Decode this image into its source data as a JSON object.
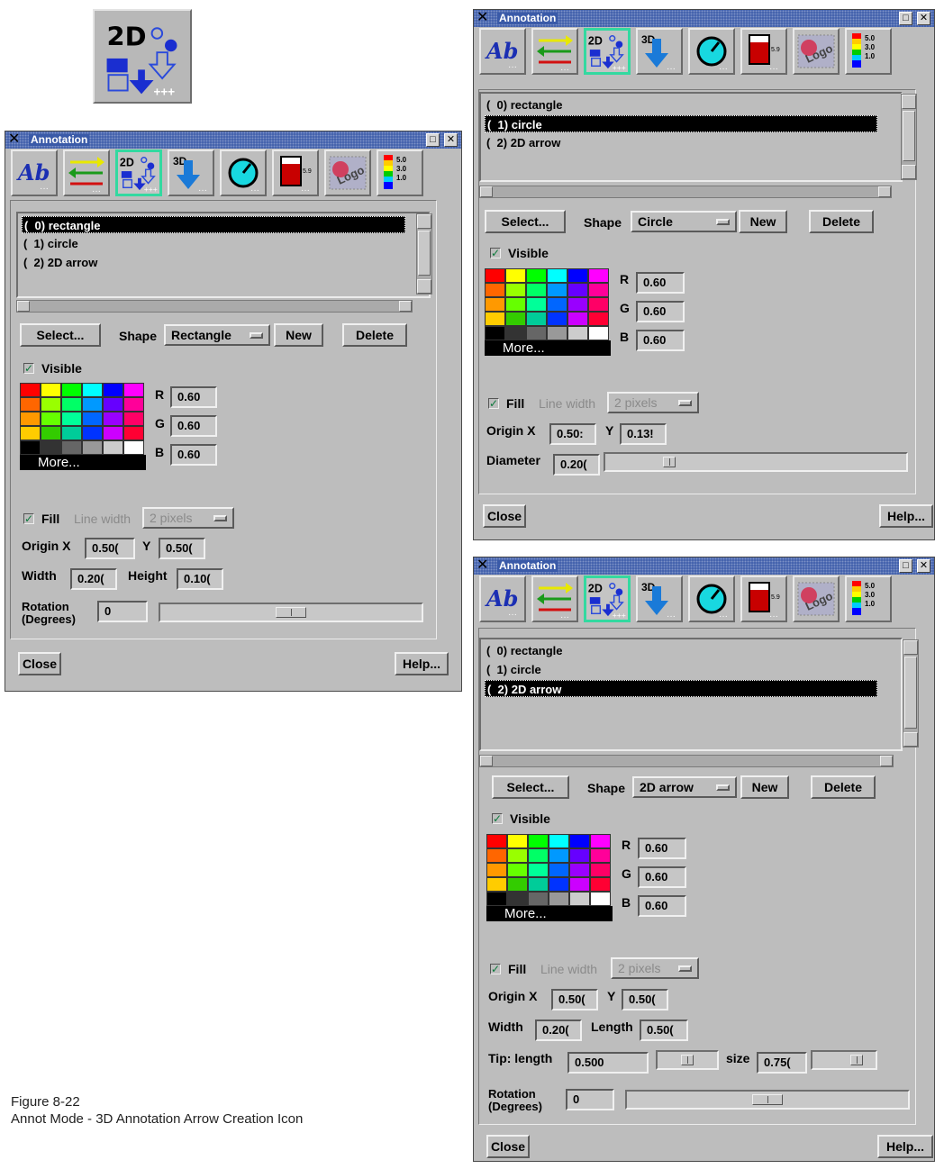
{
  "caption": {
    "line1": "Figure 8-22",
    "line2": "Annot Mode - 3D Annotation Arrow Creation Icon"
  },
  "big_icon": {
    "label": "2D"
  },
  "window_common": {
    "title": "Annotation",
    "tools": [
      "text-tool-icon",
      "line-tool-icon",
      "2d-shape-tool-icon",
      "3d-arrow-tool-icon",
      "dial-tool-icon",
      "color-bar-tool-icon",
      "logo-tool-icon",
      "legend-tool-icon"
    ],
    "tool_glyphs": {
      "text": "Ab",
      "shape2d": "2D",
      "arrow3d": "3D",
      "colorbar": "5.9",
      "logo": "Logo",
      "legend_values": [
        "5.0",
        "3.0",
        "1.0"
      ]
    },
    "list_items": [
      "(  0) rectangle",
      "(  1) circle",
      "(  2) 2D arrow"
    ],
    "select_label": "Select...",
    "shape_label": "Shape",
    "new_label": "New",
    "delete_label": "Delete",
    "visible_label": "Visible",
    "r_label": "R",
    "g_label": "G",
    "b_label": "B",
    "more_label": "More...",
    "fill_label": "Fill",
    "line_width_label": "Line width",
    "line_width_value": "2 pixels",
    "origin_x_label": "Origin X",
    "origin_y_label": "Y",
    "close_label": "Close",
    "help_label": "Help...",
    "palette": [
      "#ff0000",
      "#ffff00",
      "#00ff00",
      "#00ffff",
      "#0000ff",
      "#ff00ff",
      "#ff6600",
      "#99ff00",
      "#00ff66",
      "#0099ff",
      "#6600ff",
      "#ff0099",
      "#ff9900",
      "#66ff00",
      "#00ff99",
      "#0066ff",
      "#9900ff",
      "#ff0066",
      "#ffcc00",
      "#33cc00",
      "#00cc99",
      "#0033ff",
      "#cc00ff",
      "#ff0033",
      "#000000",
      "#333333",
      "#666666",
      "#999999",
      "#cccccc",
      "#ffffff"
    ],
    "accent_active": "#33d9a0",
    "titlebar_color": "#3a5aa8"
  },
  "rect_window": {
    "selected_index": 0,
    "shape_value": "Rectangle",
    "r": "0.60",
    "g": "0.60",
    "b": "0.60",
    "origin_x": "0.50(",
    "origin_y": "0.50(",
    "width_label": "Width",
    "width": "0.20(",
    "height_label": "Height",
    "height": "0.10(",
    "rotation_label_1": "Rotation",
    "rotation_label_2": "(Degrees)",
    "rotation": "0",
    "rotation_fraction": 0.5
  },
  "circle_window": {
    "selected_index": 1,
    "shape_value": "Circle",
    "r": "0.60",
    "g": "0.60",
    "b": "0.60",
    "origin_x": "0.50:",
    "origin_y": "0.13!",
    "diameter_label": "Diameter",
    "diameter": "0.20(",
    "diameter_fraction": 0.2
  },
  "arrow_window": {
    "selected_index": 2,
    "shape_value": "2D arrow",
    "r": "0.60",
    "g": "0.60",
    "b": "0.60",
    "origin_x": "0.50(",
    "origin_y": "0.50(",
    "width_label": "Width",
    "width": "0.20(",
    "length_label": "Length",
    "length": "0.50(",
    "tip_length_label": "Tip: length",
    "tip_length": "0.500",
    "size_label": "size",
    "size": "0.75(",
    "tip_length_fraction": 0.5,
    "size_fraction": 0.75,
    "rotation_label_1": "Rotation",
    "rotation_label_2": "(Degrees)",
    "rotation": "0",
    "rotation_fraction": 0.5
  }
}
